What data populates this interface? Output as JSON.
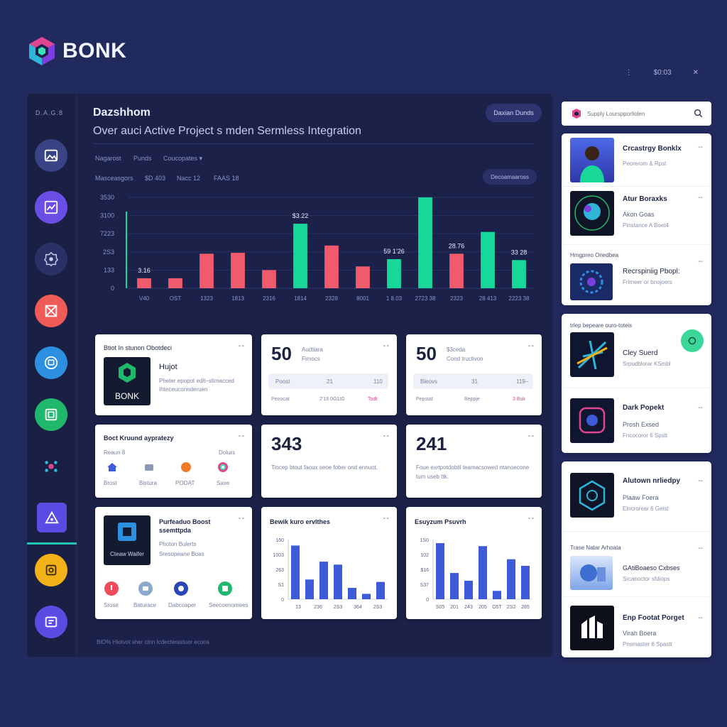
{
  "brand": {
    "name": "BONK"
  },
  "top_controls": {
    "menu_glyph": "⋮",
    "time": "$0:03",
    "close_glyph": "✕"
  },
  "rail": {
    "tag": "D.A.G.8"
  },
  "colors": {
    "background": "#212a5c",
    "panel": "#1b2149",
    "accent_green": "#17d898",
    "accent_red": "#ef5b6c",
    "accent_blue": "#3d5bd9"
  },
  "header": {
    "title": "Dazshhom",
    "subtitle": "Over auci Active Project s mden Sermless Integration",
    "pill_button": "Daxian  Dunds",
    "filters_row1": [
      "Nagarost",
      "Punds",
      "Coucopates ▾"
    ],
    "filters_row2": [
      "Masceasgors",
      "$D 403",
      "Nacc  12",
      "FAAS  18"
    ],
    "secondary_button": "Decoamaaross"
  },
  "chart_data": {
    "type": "bar",
    "y_ticks": [
      "0",
      "133",
      "2S3",
      "7223",
      "3100",
      "3530"
    ],
    "x_labels": [
      "V40",
      "OST",
      "1323",
      "1813",
      "2316",
      "1814",
      "2328",
      "8001",
      "1 8.03",
      "2723 38",
      "2323",
      "28 413",
      "2223 38"
    ],
    "values": [
      0.11,
      0.11,
      0.38,
      0.39,
      0.2,
      0.71,
      0.47,
      0.24,
      0.32,
      1.0,
      0.38,
      0.62,
      0.31
    ],
    "colors": [
      "red",
      "red",
      "red",
      "red",
      "red",
      "green",
      "red",
      "red",
      "green",
      "green",
      "red",
      "green",
      "green"
    ],
    "data_labels": [
      {
        "bar": 0,
        "text": "3.16"
      },
      {
        "bar": 5,
        "text": "$3.22"
      },
      {
        "bar": 8,
        "text": "59 1’26"
      },
      {
        "bar": 10,
        "text": "28.76"
      },
      {
        "bar": 12,
        "text": "33 28"
      }
    ],
    "ylim": [
      0,
      1
    ],
    "grid": true
  },
  "cards": {
    "project": {
      "header": "Btiot In stunon Obotdeci",
      "name": "Hujot",
      "desc": "Pheter epopot edit–stimacced Ihteceuconnderuen",
      "logo_text": "BONK"
    },
    "stat1": {
      "value": "50",
      "label": "Audtiara",
      "sub": "Fimocs",
      "row1": [
        "Poost",
        "21",
        "110"
      ],
      "row2": [
        "Peoocat",
        "2’16 0G1tG",
        "Todt"
      ]
    },
    "stat2": {
      "value": "50",
      "label": "$3ceda",
      "sub": "Cond tructivon",
      "row1": [
        "Bleovs",
        "31",
        "119–"
      ],
      "row2": [
        "Pepstat",
        "Beppje",
        "3 Buk"
      ]
    },
    "quick": {
      "header": "Boct Kruund aypratezy",
      "left_label": "Reaun 8",
      "right_label": "Dolurs",
      "items": [
        "Brost",
        "Bistura",
        "POOAT",
        "Saxe"
      ]
    },
    "num1": {
      "value": "343",
      "desc": "Tiocep btout faoux seoe fober ond ennuot."
    },
    "num2": {
      "value": "241",
      "desc": "Foue exrtpotdoblil teamacsowed ntanoecone tum useb ttk."
    },
    "boost": {
      "title": "Purfeaduo Boost",
      "title2": "ssemttpda",
      "line1": "Photon Bulerts",
      "line2": "Sresopeane Boas",
      "logo_text": "Cteaw Waifer",
      "items": [
        "Srose",
        "Baturace",
        "Dabcoaper",
        "Seecoenomees"
      ]
    },
    "mini1": {
      "title": "Bewik kuro ervlthes",
      "y_ticks": [
        "160",
        "1003",
        "263",
        "S1",
        "0"
      ],
      "x_labels": [
        "13",
        "236",
        "2S3",
        "364",
        "2S3"
      ]
    },
    "mini2": {
      "title": "Esuyzum Psuvrh",
      "y_ticks": [
        "1S0",
        "102",
        "$16",
        "S37",
        "0"
      ],
      "x_labels": [
        "S05",
        "201",
        "243",
        "205",
        "O5T",
        "2S2",
        "285"
      ]
    }
  },
  "mini_chart_data": [
    {
      "type": "bar",
      "values": [
        0.9,
        0.33,
        0.63,
        0.58,
        0.19,
        0.09,
        0.29
      ]
    },
    {
      "type": "bar",
      "values": [
        0.94,
        0.44,
        0.31,
        0.89,
        0.14,
        0.67,
        0.56
      ]
    }
  ],
  "footer": {
    "text": "BlO%   Hiotvot sher cinn Icdecterastuor econs"
  },
  "search": {
    "placeholder": "Supply Lourspporliolen"
  },
  "right_group1": {
    "items": [
      {
        "name": "Crcastrgy Bonklx",
        "sub": "Peorerom & Rpst",
        "meta": ""
      },
      {
        "name": "Atur Boraxks",
        "sub": "Akon  Goas",
        "meta": "Pinstance  A Boet4"
      },
      {
        "name": "Recrspiniig Pbopl:",
        "sub": "Frlmeer or bnojoers",
        "meta": ""
      }
    ],
    "section_header": "Hmgpreo Onedbea"
  },
  "right_group2": {
    "header": "trlep  bepeare ouro-toteis",
    "items": [
      {
        "name": "Cley Suerd",
        "sub": "Srpudblorar KSmbl"
      },
      {
        "name": "Dark Popekt",
        "sub": "Prosh Exsed",
        "meta": "Fncocoror  6 Spstt"
      }
    ]
  },
  "right_group3": {
    "items": [
      {
        "name": "Alutown nrliedpy",
        "sub": "Plaaw Foera",
        "meta": "Elncrorear  6 Geist"
      },
      {
        "name": "GAtiBoaeso Cxbses",
        "sub": "Srcanoctor sfdiops",
        "meta": ""
      },
      {
        "name": "Enp Footat Porget",
        "sub": "Virah Boera",
        "meta": "Pnsmaster  6 Spastt"
      }
    ],
    "section_header": "Trase Natar Arhoata"
  }
}
